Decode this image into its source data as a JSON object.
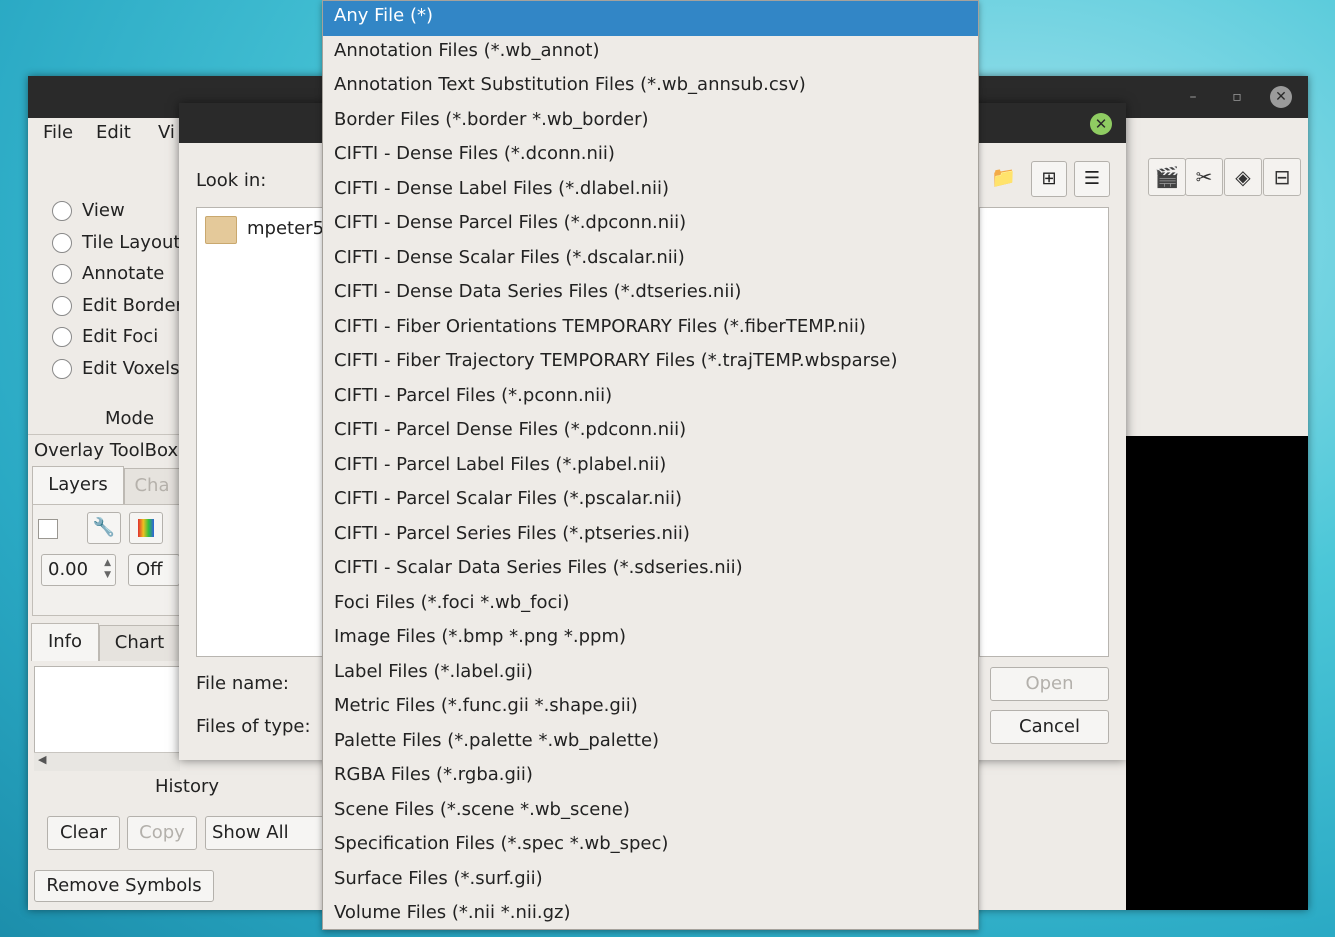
{
  "main_window": {
    "menus": [
      "File",
      "Edit",
      "Vi"
    ],
    "mode_options": [
      "View",
      "Tile Layout",
      "Annotate",
      "Edit Border",
      "Edit Foci",
      "Edit Voxels"
    ],
    "mode_label": "Mode",
    "overlay_toolbox_title": "Overlay ToolBox",
    "overlay_tabs": [
      "Layers",
      "Cha"
    ],
    "threshold_value": "0.00",
    "off_label": "Off",
    "info_tabs": [
      "Info",
      "Chart"
    ],
    "history_label": "History",
    "clear_button": "Clear",
    "copy_button": "Copy",
    "show_all_value": "Show All",
    "remove_symbols_button": "Remove Symbols"
  },
  "file_dialog": {
    "look_in_label": "Look in:",
    "folder_item": "mpeter5",
    "file_name_label": "File name:",
    "files_of_type_label": "Files of type:",
    "open_button": "Open",
    "cancel_button": "Cancel"
  },
  "file_type_dropdown": {
    "selected_index": 0,
    "items": [
      "Any File (*)",
      "Annotation Files (*.wb_annot)",
      "Annotation Text Substitution Files (*.wb_annsub.csv)",
      "Border Files (*.border *.wb_border)",
      "CIFTI - Dense Files (*.dconn.nii)",
      "CIFTI - Dense Label Files (*.dlabel.nii)",
      "CIFTI - Dense Parcel Files (*.dpconn.nii)",
      "CIFTI - Dense Scalar Files (*.dscalar.nii)",
      "CIFTI - Dense Data Series Files (*.dtseries.nii)",
      "CIFTI - Fiber Orientations TEMPORARY Files (*.fiberTEMP.nii)",
      "CIFTI - Fiber Trajectory TEMPORARY Files (*.trajTEMP.wbsparse)",
      "CIFTI - Parcel Files (*.pconn.nii)",
      "CIFTI - Parcel Dense Files (*.pdconn.nii)",
      "CIFTI - Parcel Label Files (*.plabel.nii)",
      "CIFTI - Parcel Scalar Files (*.pscalar.nii)",
      "CIFTI - Parcel Series Files (*.ptseries.nii)",
      "CIFTI - Scalar Data Series Files (*.sdseries.nii)",
      "Foci Files (*.foci *.wb_foci)",
      "Image Files (*.bmp *.png *.ppm)",
      "Label Files (*.label.gii)",
      "Metric Files (*.func.gii *.shape.gii)",
      "Palette Files (*.palette *.wb_palette)",
      "RGBA Files (*.rgba.gii)",
      "Scene Files (*.scene *.wb_scene)",
      "Specification Files (*.spec *.wb_spec)",
      "Surface Files (*.surf.gii)",
      "Volume Files (*.nii *.nii.gz)"
    ]
  },
  "colors": {
    "selection": "#3286c6",
    "titlebar": "#2a2a2a",
    "window_bg": "#eeebe7",
    "close_green": "#8fcc62"
  }
}
